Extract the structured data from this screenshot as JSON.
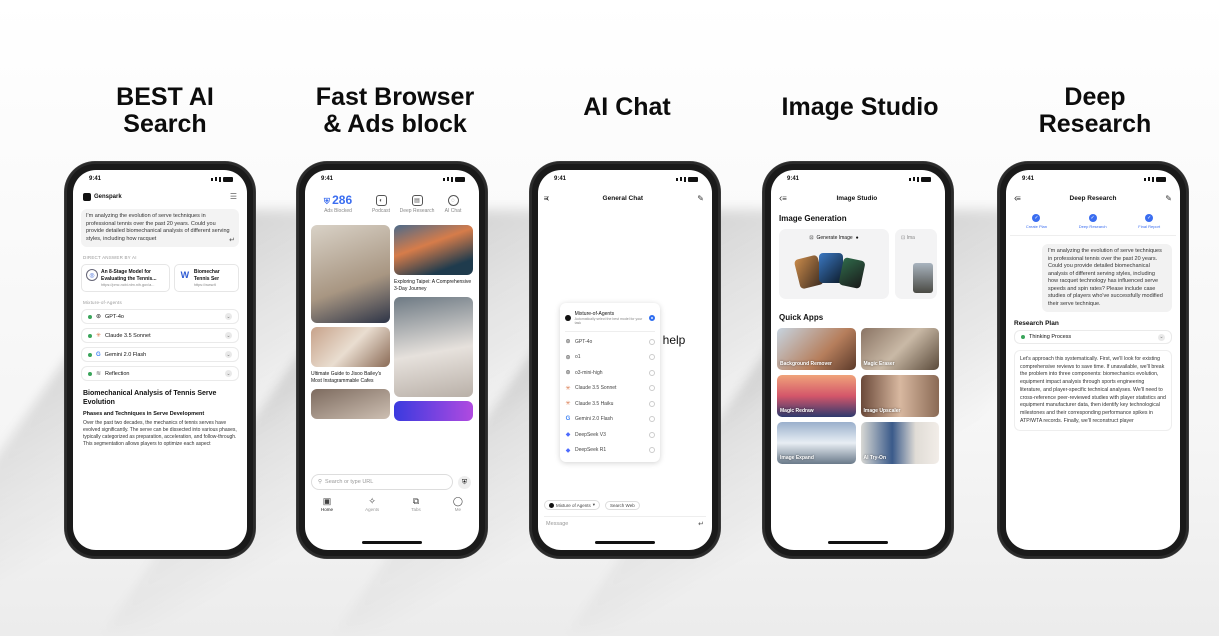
{
  "headings": {
    "search": "BEST AI\nSearch",
    "browser": "Fast Browser\n& Ads block",
    "chat": "AI Chat",
    "image": "Image Studio",
    "research": "Deep\nResearch"
  },
  "status_time": "9:41",
  "search_phone": {
    "app_name": "Genspark",
    "query": "I'm analyzing the evolution of serve techniques in professional tennis over the past 20 years. Could you provide detailed biomechanical analysis of different serving styles, including how racquet",
    "direct_label": "DIRECT ANSWER BY AI",
    "card1_title": "An 8-Stage Model for Evaluating the Tennis...",
    "card1_url": "https://pmc.ncbi.nlm.nih.gov/a...",
    "card2_title": "Biomechar Tennis Ser",
    "card2_url": "https://www.tl",
    "agents_label": "Mixture-of-Agents",
    "agents": [
      "GPT-4o",
      "Claude 3.5 Sonnet",
      "Gemini 2.0 Flash",
      "Reflection"
    ],
    "answer_title": "Biomechanical Analysis of Tennis Serve Evolution",
    "answer_sub": "Phases and Techniques in Serve Development",
    "answer_body": "Over the past two decades, the mechanics of tennis serves have evolved significantly. The serve can be dissected into various phases, typically categorized as preparation, acceleration, and follow-through. This segmentation allows players to optimize each aspect"
  },
  "browser_phone": {
    "ads_count": "286",
    "ads_label": "Ads Blocked",
    "tools": [
      "Podcast",
      "Deep Research",
      "AI Chat"
    ],
    "card1": "Exploring Taipei: A Comprehensive 3-Day Journey",
    "card2": "Ultimate Guide to Jisoo Bailey's Most Instagrammable Cafes",
    "search_placeholder": "Search or type URL",
    "tabs": [
      "Home",
      "Agents",
      "Tabs",
      "Me"
    ]
  },
  "chat_phone": {
    "title": "General Chat",
    "help_text": "I help",
    "menu_head": "Mixture-of-Agents",
    "menu_sub": "Automatically select the best model for your task",
    "models": [
      "GPT-4o",
      "o1",
      "o3-mini-high",
      "Claude 3.5 Sonnet",
      "Claude 3.5 Haiku",
      "Gemini 2.0 Flash",
      "DeepSeek V3",
      "DeepSeek R1"
    ],
    "selector": "Mixture of Agents",
    "search_web": "Search Web",
    "message_placeholder": "Message"
  },
  "image_phone": {
    "title": "Image Studio",
    "gen_heading": "Image Generation",
    "gen_button": "Generate Image",
    "gen_card2_label": "Ima",
    "apps_heading": "Quick Apps",
    "apps": [
      "Background Remover",
      "Magic Eraser",
      "Magic Redraw",
      "Image Upscaler",
      "Image Expand",
      "AI Try-On"
    ]
  },
  "research_phone": {
    "title": "Deep Research",
    "steps": [
      "Create Plan",
      "Deep Research",
      "Final Report"
    ],
    "question": "I'm analyzing the evolution of serve techniques in professional tennis over the past 20 years. Could you provide detailed biomechanical analysis of different serving styles, including how racquet technology has influenced serve speeds and spin rates? Please include case studies of players who've successfully modified their serve technique.",
    "plan_heading": "Research Plan",
    "thinking": "Thinking Process",
    "plan_body": "Let's approach this systematically. First, we'll look for existing comprehensive reviews to save time. If unavailable, we'll break the problem into three components: biomechanics evolution, equipment impact analysis through sports engineering literature, and player-specific technical analyses. We'll need to cross-reference peer-reviewed studies with player statistics and equipment manufacturer data, then identify key technological milestones and their corresponding performance spikes in ATP/WTA records. Finally, we'll reconstruct player"
  },
  "colors": {
    "accent": "#3a6df0",
    "agent_dot": "#3aa55b"
  }
}
